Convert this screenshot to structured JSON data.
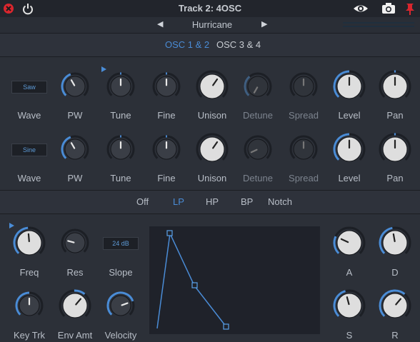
{
  "titlebar": {
    "title": "Track 2: 4OSC"
  },
  "preset": {
    "name": "Hurricane"
  },
  "osc_tabs": [
    {
      "label": "OSC 1 & 2",
      "active": true
    },
    {
      "label": "OSC 3 & 4",
      "active": false
    }
  ],
  "osc_rows": [
    {
      "wave": "Saw",
      "labels": [
        "Wave",
        "PW",
        "Tune",
        "Fine",
        "Unison",
        "Detune",
        "Spread",
        "Level",
        "Pan"
      ]
    },
    {
      "wave": "Sine",
      "labels": [
        "Wave",
        "PW",
        "Tune",
        "Fine",
        "Unison",
        "Detune",
        "Spread",
        "Level",
        "Pan"
      ]
    }
  ],
  "filter_types": [
    {
      "label": "Off",
      "active": false
    },
    {
      "label": "LP",
      "active": true
    },
    {
      "label": "HP",
      "active": false
    },
    {
      "label": "BP",
      "active": false
    },
    {
      "label": "Notch",
      "active": false
    }
  ],
  "filter": {
    "slope": "24 dB",
    "labels": {
      "freq": "Freq",
      "res": "Res",
      "slope": "Slope",
      "keytrk": "Key Trk",
      "envamt": "Env Amt",
      "velocity": "Velocity"
    }
  },
  "envelope": {
    "labels": {
      "a": "A",
      "d": "D",
      "s": "S",
      "r": "R"
    }
  },
  "colors": {
    "accent": "#4a8cd6",
    "background": "#2b2f37",
    "knob_face": "#3a3e46",
    "knob_face_light": "#dcdcdc"
  }
}
